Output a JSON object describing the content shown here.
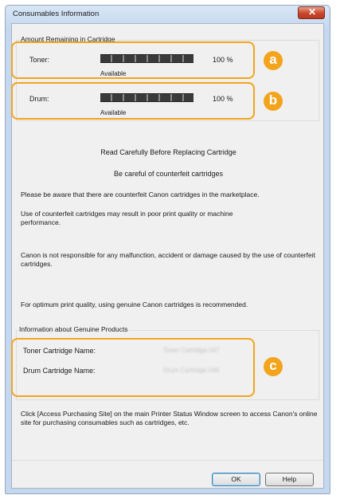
{
  "window": {
    "title": "Consumables Information",
    "close_symbol": "✕"
  },
  "remaining": {
    "group_label": "Amount Remaining in Cartridge",
    "toner": {
      "label": "Toner:",
      "percent": "100 %",
      "status": "Available",
      "level": 1.0
    },
    "drum": {
      "label": "Drum:",
      "percent": "100 %",
      "status": "Available",
      "level": 1.0
    }
  },
  "notice": {
    "heading": "Read Carefully Before Replacing Cartridge",
    "subheading": "Be careful of counterfeit cartridges",
    "p1": "Please be aware that there are counterfeit Canon cartridges in the marketplace.",
    "p2": "Use of counterfeit cartridges may result in poor print quality or machine performance.",
    "p3": "Canon is not responsible for any malfunction, accident or damage caused by the use of counterfeit cartridges.",
    "p4": "For optimum print quality, using genuine Canon cartridges is recommended."
  },
  "genuine": {
    "group_label": "Information about Genuine Products",
    "toner_name_label": "Toner Cartridge Name:",
    "toner_name_value": "Toner Cartridge 047",
    "drum_name_label": "Drum Cartridge Name:",
    "drum_name_value": "Drum Cartridge 049"
  },
  "footer_text": "Click [Access Purchasing Site] on the main Printer Status Window screen to access Canon's online site for purchasing consumables such as cartridges, etc.",
  "buttons": {
    "ok": "OK",
    "help": "Help"
  },
  "callouts": {
    "a": "a",
    "b": "b",
    "c": "c"
  },
  "colors": {
    "callout": "#f3a41c"
  }
}
